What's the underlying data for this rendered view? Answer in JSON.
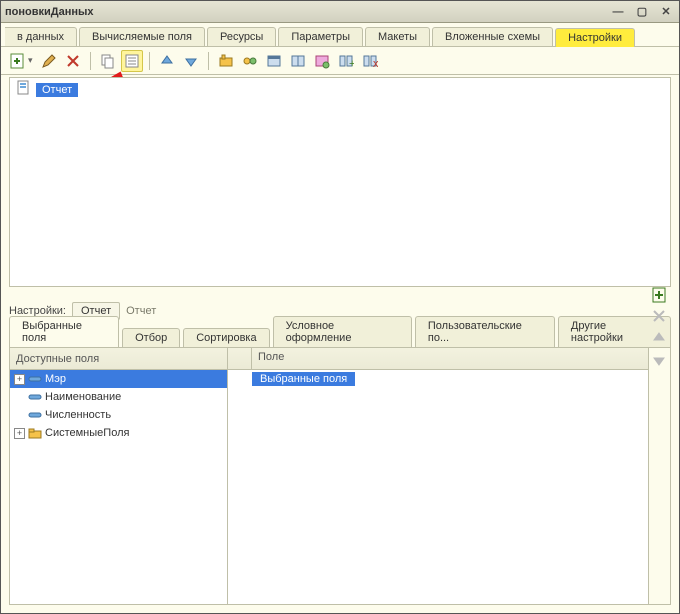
{
  "window": {
    "title": "поновкиДанных"
  },
  "main_tabs": [
    {
      "label": "в данных"
    },
    {
      "label": "Вычисляемые поля"
    },
    {
      "label": "Ресурсы"
    },
    {
      "label": "Параметры"
    },
    {
      "label": "Макеты"
    },
    {
      "label": "Вложенные схемы"
    },
    {
      "label": "Настройки"
    }
  ],
  "tree": {
    "root_label": "Отчет"
  },
  "settings_row": {
    "label": "Настройки:",
    "chip": "Отчет",
    "crumb": "Отчет"
  },
  "sub_tabs": [
    {
      "label": "Выбранные поля"
    },
    {
      "label": "Отбор"
    },
    {
      "label": "Сортировка"
    },
    {
      "label": "Условное оформление"
    },
    {
      "label": "Пользовательские по..."
    },
    {
      "label": "Другие настройки"
    }
  ],
  "avail": {
    "header": "Доступные поля",
    "rows": [
      {
        "label": "Мэр",
        "expander": "+",
        "icon": "attr",
        "selected": true
      },
      {
        "label": "Наименование",
        "expander": "",
        "icon": "attr",
        "selected": false
      },
      {
        "label": "Численность",
        "expander": "",
        "icon": "attr",
        "selected": false
      },
      {
        "label": "СистемныеПоля",
        "expander": "+",
        "icon": "folder",
        "selected": false
      }
    ]
  },
  "selected": {
    "header": "Поле",
    "group_label": "Выбранные поля"
  },
  "icons": {
    "add": "add-icon",
    "pencil": "pencil-icon",
    "delete": "delete-icon",
    "copy": "copy-icon",
    "wizard": "wizard-icon",
    "up": "arrow-up-icon",
    "down": "arrow-down-icon",
    "tool1": "tool1-icon",
    "tool2": "tool2-icon",
    "tool3": "tool3-icon",
    "tool4": "tool4-icon",
    "tool5": "tool5-icon",
    "tool6": "tool6-icon",
    "tool7": "tool7-icon",
    "vadd": "add-icon",
    "vdel": "delete-icon",
    "vup": "arrow-up-icon",
    "vdown": "arrow-down-icon"
  }
}
